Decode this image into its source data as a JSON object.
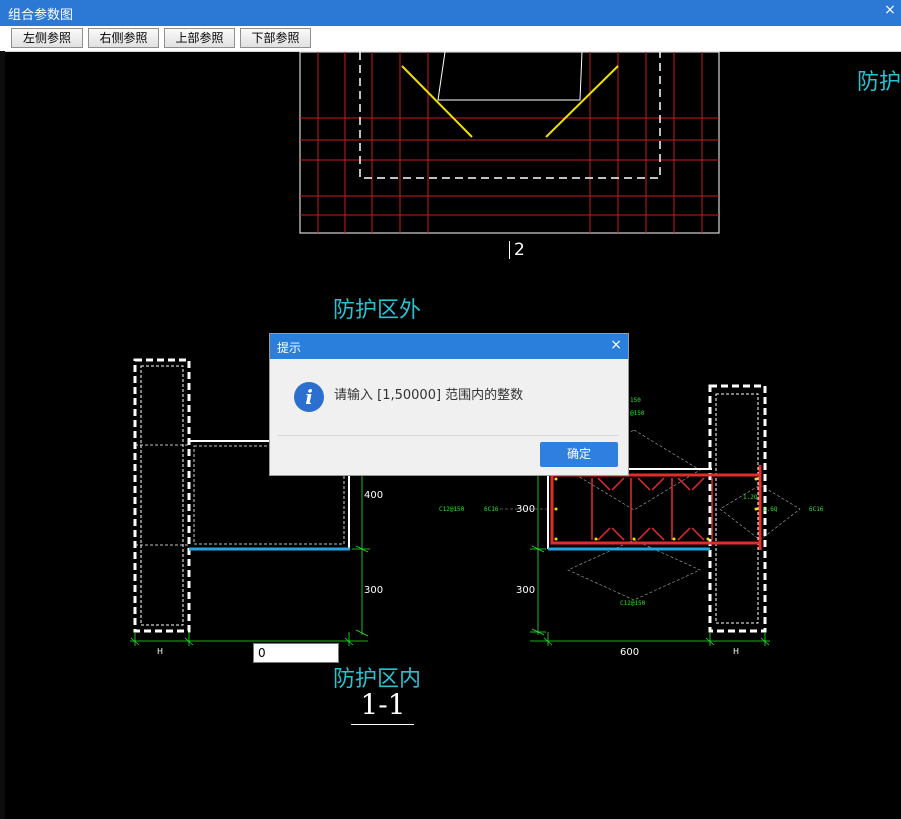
{
  "window": {
    "title": "组合参数图",
    "close_glyph": "×"
  },
  "toolbar": {
    "buttons": [
      "左侧参照",
      "右侧参照",
      "上部参照",
      "下部参照"
    ]
  },
  "drawing": {
    "label_top_right": "防护",
    "label_outside": "防护区外",
    "label_inside": "防护区内",
    "section_mark": "1-1",
    "axis_number": "2",
    "dims": {
      "d400": "400",
      "d300_left": "300",
      "d300_right": "300",
      "d600": "600",
      "h_left": "H",
      "h_right": "H"
    },
    "rebar_labels": {
      "c12_left": "C12@150",
      "c6c16_left": "6C16",
      "c6c16_right": "6C16",
      "c12_bottom": "C12@150",
      "c_top1": "150",
      "c_top2": "@150",
      "side1": "1.2Q",
      "side2": "1.6Q"
    },
    "colors": {
      "cyan": "#27c1d1",
      "red": "#c81e1e",
      "yellow": "#f0e000",
      "blue": "#29a3e0",
      "green": "#27e827",
      "bar_red": "#e32d2d"
    }
  },
  "input": {
    "value": "0"
  },
  "dialog": {
    "title": "提示",
    "close_glyph": "×",
    "icon": "info-icon",
    "icon_glyph": "i",
    "message": "请输入 [1,50000] 范围内的整数",
    "ok_label": "确定"
  }
}
